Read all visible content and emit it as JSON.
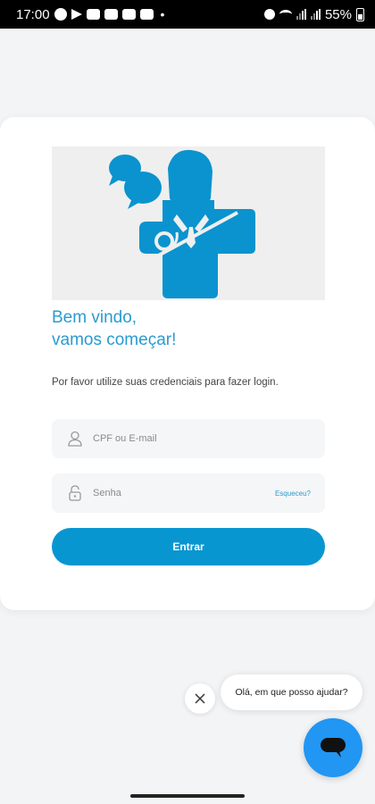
{
  "status_bar": {
    "time": "17:00",
    "battery": "55%",
    "left_icons": [
      "message-icon",
      "telegram-icon",
      "youtube-icon",
      "youtube-icon",
      "youtube-icon",
      "youtube-icon"
    ],
    "right_icons": [
      "alarm-icon",
      "wifi-icon",
      "signal-icon",
      "signal-icon",
      "battery-icon"
    ]
  },
  "login": {
    "hero_icon": "doctor-chat-cross-icon",
    "welcome_line1": "Bem vindo,",
    "welcome_line2": "vamos começar!",
    "instructions": "Por favor utilize suas credenciais para fazer login.",
    "cpf_placeholder": "CPF ou E-mail",
    "cpf_value": "",
    "password_placeholder": "Senha",
    "password_value": "",
    "forgot_label": "Esqueceu?",
    "submit_label": "Entrar"
  },
  "chat": {
    "greeting": "Olá, em que posso ajudar?",
    "close_icon": "close-icon",
    "fab_icon": "chat-icon"
  },
  "colors": {
    "accent": "#0896d1",
    "welcome_text": "#2a9bd0",
    "chat_fab": "#2196f3"
  }
}
